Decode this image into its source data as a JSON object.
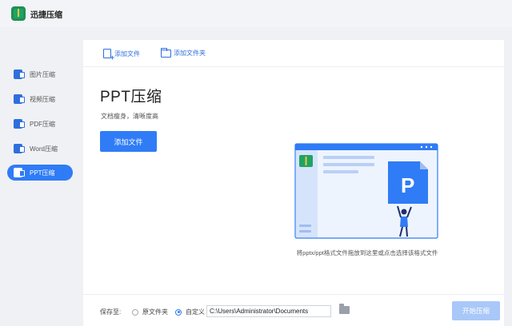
{
  "app": {
    "title": "迅捷压缩"
  },
  "sidebar": {
    "items": [
      {
        "label": "图片压缩",
        "active": false
      },
      {
        "label": "视频压缩",
        "active": false
      },
      {
        "label": "PDF压缩",
        "active": false
      },
      {
        "label": "Word压缩",
        "active": false
      },
      {
        "label": "PPT压缩",
        "active": true
      }
    ]
  },
  "toolbar": {
    "add_file": "添加文件",
    "add_folder": "添加文件夹"
  },
  "main": {
    "title": "PPT压缩",
    "subtitle": "文档瘦身，清晰度高",
    "add_button": "添加文件",
    "drop_hint": "将pptx/ppt格式文件拖放到这里或点击选择该格式文件"
  },
  "bottom": {
    "save_to": "保存至:",
    "option_original": "原文件夹",
    "option_custom": "自定义",
    "selected_option": "自定义",
    "path_value": "C:\\Users\\Administrator\\Documents",
    "start_button": "开始压缩"
  },
  "colors": {
    "accent": "#2f7cf6",
    "start_disabled": "#a9c8f8",
    "ppt_orange": "#2f7cf6"
  },
  "illustration": {
    "glyph": "P"
  }
}
